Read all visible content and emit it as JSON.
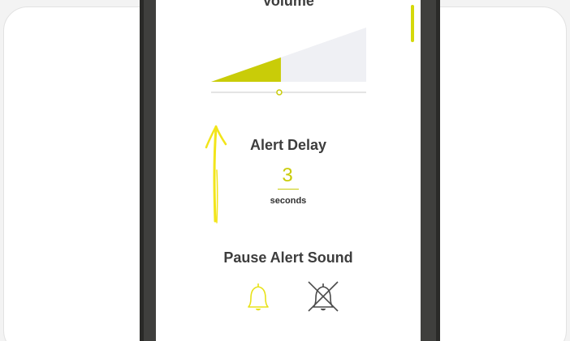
{
  "volume": {
    "title": "Volume",
    "level": 0.45
  },
  "alert_delay": {
    "title": "Alert Delay",
    "value": "3",
    "unit": "seconds"
  },
  "pause_alert_sound": {
    "title": "Pause Alert Sound"
  },
  "icons": {
    "sound_on": "bell-icon",
    "sound_off": "bell-off-icon",
    "decoration": "hand-drawn-arrow-icon"
  },
  "colors": {
    "accent": "#c9cc08",
    "arrow": "#f2e51a",
    "track": "#eff0f4",
    "text": "#3d3d3d",
    "frame": "#3f3f3d"
  }
}
